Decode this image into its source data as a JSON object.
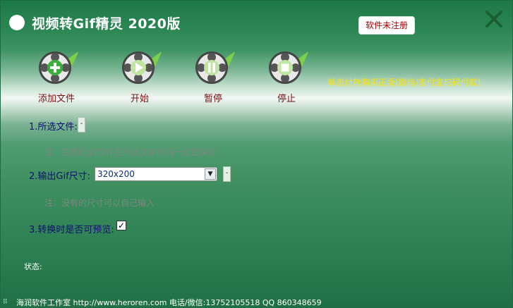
{
  "window": {
    "title": "视频转Gif精灵 2020版",
    "unregistered_label": "软件未注册",
    "close_glyph": "✕"
  },
  "toolbar": {
    "items": [
      {
        "label": "添加文件",
        "icon": "add-icon"
      },
      {
        "label": "开始",
        "icon": "play-icon"
      },
      {
        "label": "暂停",
        "icon": "pause-icon"
      },
      {
        "label": "停止",
        "icon": "stop-icon"
      }
    ],
    "promo_text": "单击付款购买正版(微信/支付宝扫码付款)"
  },
  "form": {
    "file_label": "1.所选文件:",
    "file_button": "-",
    "file_note": "注：生成的gif文件在所选文件的同一位置保存",
    "size_label": "2.输出Gif尺寸:",
    "size_value": "320x200",
    "size_button": "-",
    "size_note": "注：没有的尺寸可以自己输入",
    "preview_label": "3.转换时是否可预览:",
    "preview_checked": true
  },
  "status": {
    "label": "状态:"
  },
  "footer": {
    "text": "海润软件工作室 http://www.heroren.com  电话/微信:13752105518  QQ 860348659"
  }
}
